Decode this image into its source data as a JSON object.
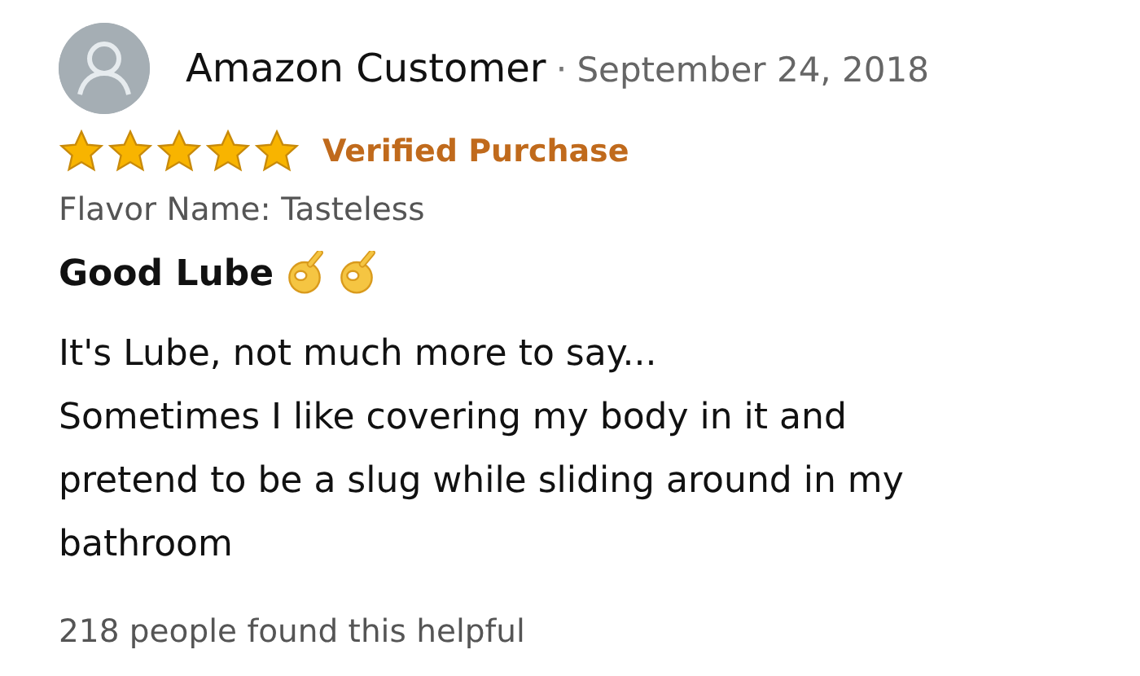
{
  "reviewer": {
    "name": "Amazon Customer",
    "separator": "·",
    "date": "September 24, 2018"
  },
  "stars": 5,
  "badge": "Verified Purchase",
  "variant": "Flavor Name: Tasteless",
  "title": "Good Lube",
  "body": [
    "It's Lube, not much more to say...",
    "Sometimes I like covering my body in it and pretend to be a slug while sliding around in my bathroom"
  ],
  "helpful": "218 people found this helpful"
}
